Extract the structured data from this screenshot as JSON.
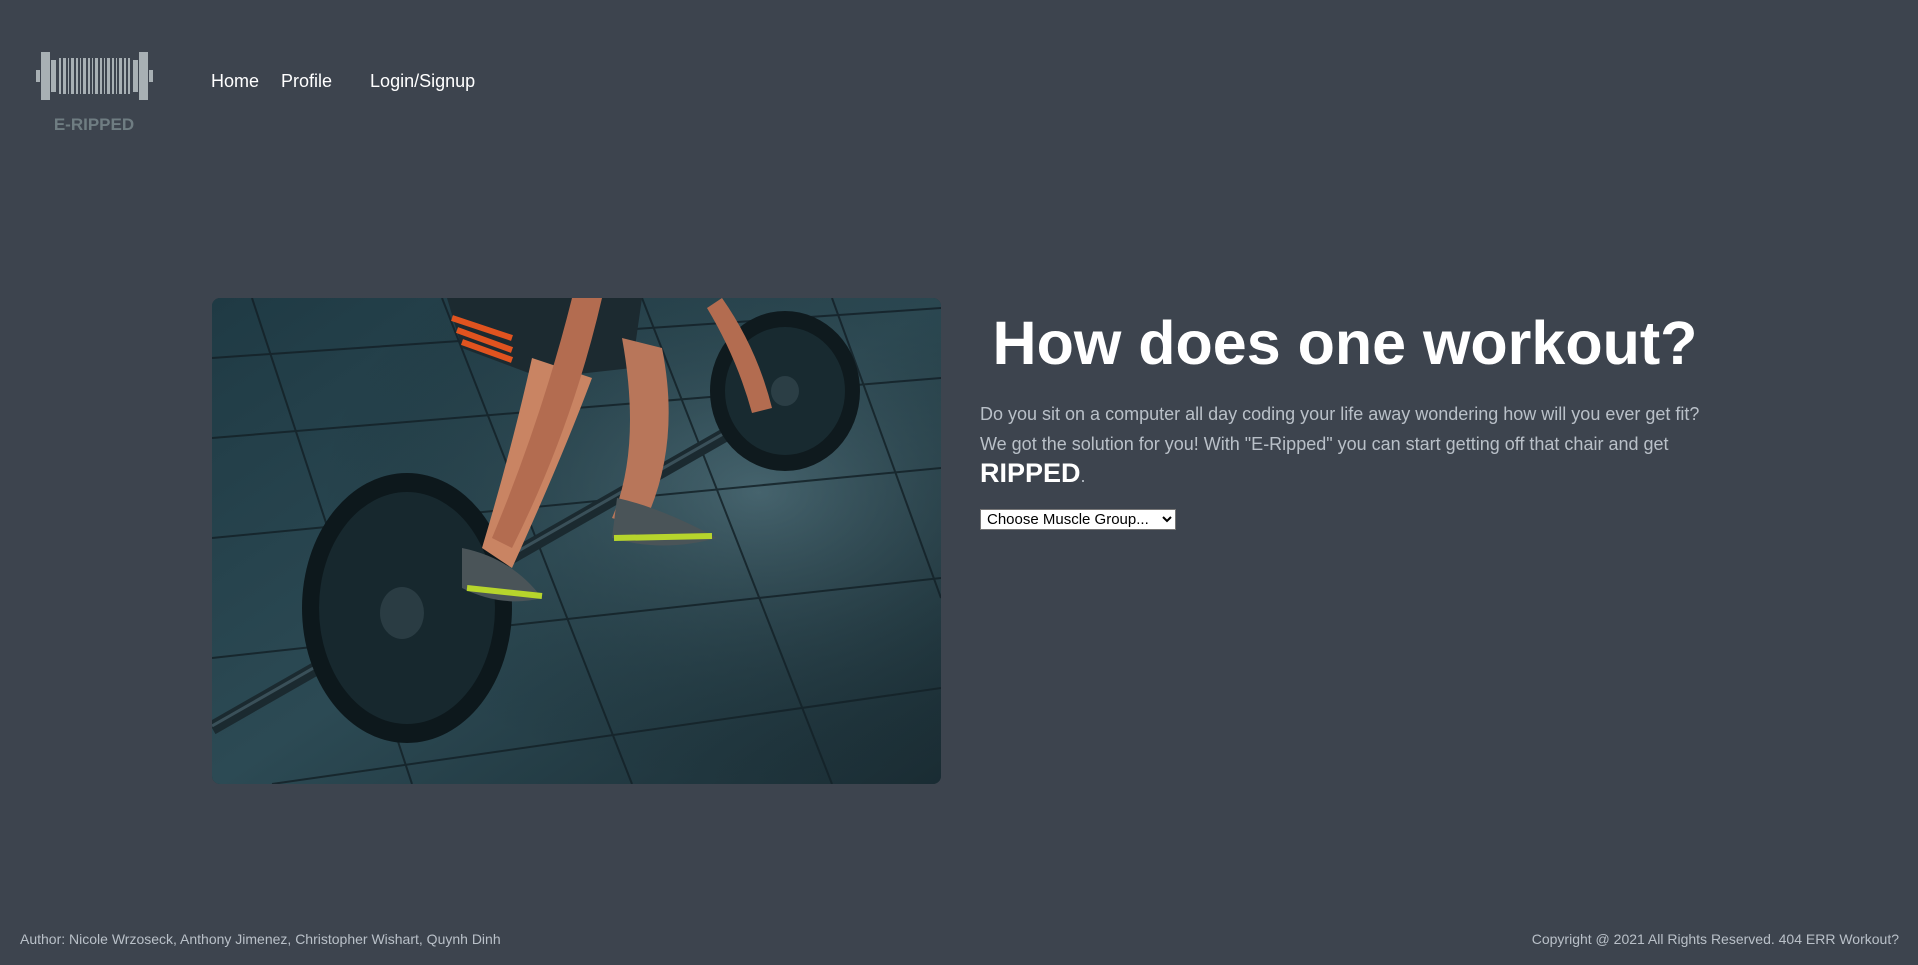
{
  "brand": {
    "logo_text": "E-RIPPED",
    "icon": "barbell-barcode-logo"
  },
  "nav": {
    "items": [
      {
        "label": "Home"
      },
      {
        "label": "Profile"
      },
      {
        "label": "Login/Signup"
      }
    ]
  },
  "hero": {
    "image_alt": "person lifting barbell in gym",
    "title": "How does one workout?",
    "text_line1": "Do you sit on a computer all day coding your life away wondering how will you ever get fit?",
    "text_line2": "We got the solution for you! With \"E-Ripped\" you can start getting off that chair and get",
    "emphasis": "RIPPED",
    "period": ".",
    "select": {
      "selected": "Choose Muscle Group..."
    }
  },
  "footer": {
    "author": "Author: Nicole Wrzoseck, Anthony Jimenez, Christopher Wishart, Quynh Dinh",
    "copyright": "Copyright @ 2021 All Rights Reserved. 404 ERR Workout?"
  },
  "colors": {
    "background": "#3d444e",
    "text": "#ffffff",
    "muted_text": "#b9c0c8"
  }
}
